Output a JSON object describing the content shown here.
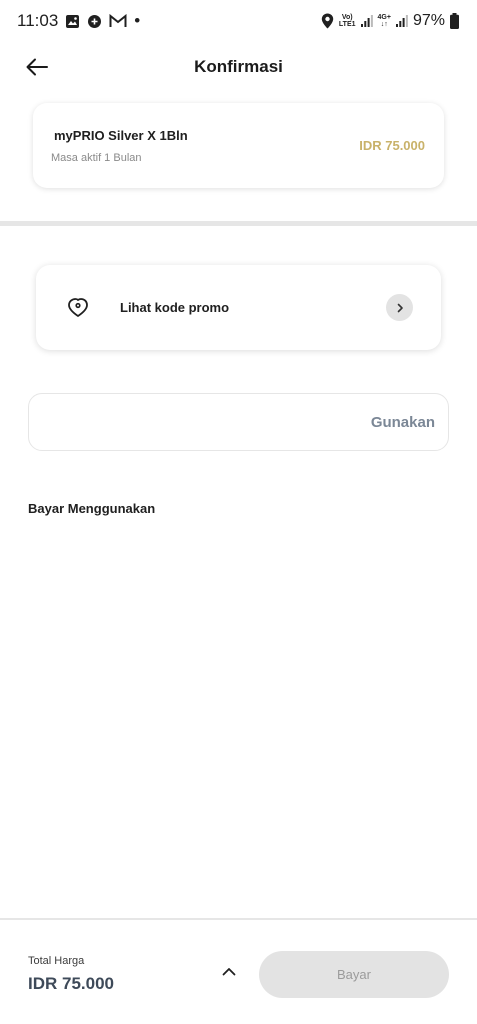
{
  "status_bar": {
    "time": "11:03",
    "volte_top": "Vo)",
    "volte_bottom": "LTE1",
    "net_top": "4G+",
    "net_bottom": "↓↑",
    "battery": "97%",
    "dot": "•"
  },
  "header": {
    "title": "Konfirmasi"
  },
  "product": {
    "name": "myPRIO Silver X 1Bln",
    "subtitle": "Masa aktif 1 Bulan",
    "price": "IDR 75.000"
  },
  "promo": {
    "label": "Lihat kode promo",
    "chevron": "›"
  },
  "promo_code": {
    "value": "",
    "apply_label": "Gunakan"
  },
  "payment": {
    "heading": "Bayar Menggunakan"
  },
  "footer": {
    "total_label": "Total Harga",
    "total_value": "IDR 75.000",
    "pay_label": "Bayar"
  },
  "colors": {
    "price_accent": "#c9b26a",
    "total_text": "#3e4a59",
    "disabled_button": "#e3e3e3"
  }
}
